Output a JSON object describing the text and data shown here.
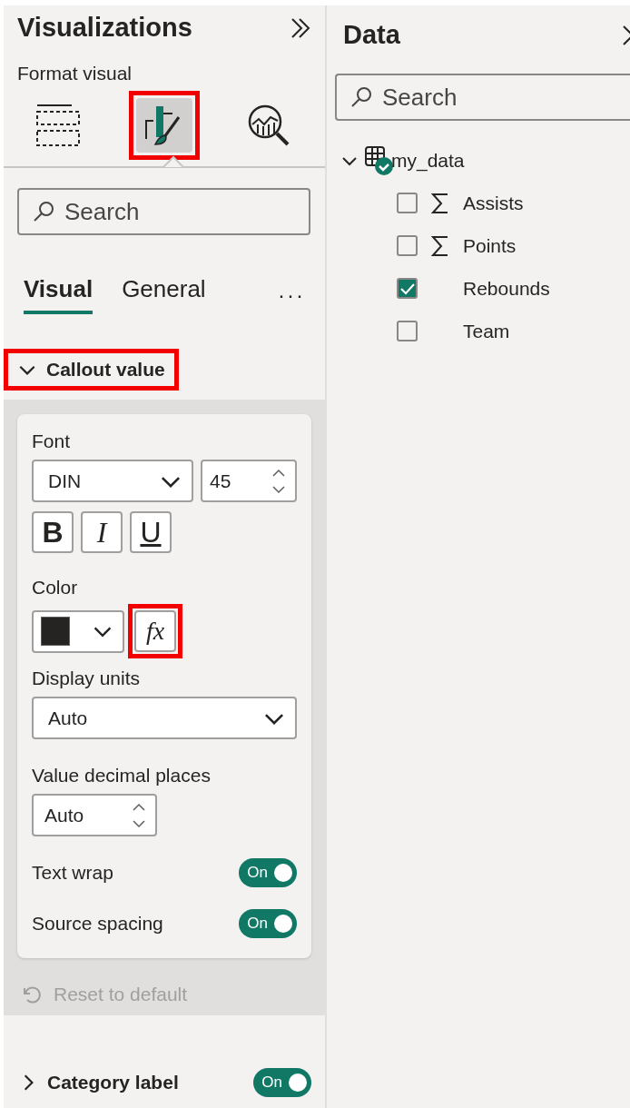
{
  "visualizations_pane": {
    "title": "Visualizations",
    "subtitle": "Format visual",
    "view_buttons": [
      {
        "kind": "build",
        "selected": false,
        "highlighted": false
      },
      {
        "kind": "format",
        "selected": true,
        "highlighted": true
      },
      {
        "kind": "analytics",
        "selected": false,
        "highlighted": false
      }
    ],
    "search": {
      "placeholder": "Search"
    },
    "tabs": [
      {
        "label": "Visual",
        "selected": true
      },
      {
        "label": "General",
        "selected": false
      }
    ],
    "more": "···",
    "callout_section": {
      "title": "Callout value",
      "expanded": true,
      "highlighted": true,
      "font": {
        "label": "Font",
        "family": "DIN",
        "size": "45",
        "styles": [
          {
            "kind": "bold",
            "label": "B"
          },
          {
            "kind": "italic",
            "label": "I"
          },
          {
            "kind": "underline",
            "label": "U"
          }
        ]
      },
      "color": {
        "label": "Color",
        "fx": {
          "label": "fx",
          "highlighted": true
        }
      },
      "display_units": {
        "label": "Display units",
        "value": "Auto"
      },
      "decimal_places": {
        "label": "Value decimal places",
        "value": "Auto"
      },
      "toggles": [
        {
          "label": "Text wrap",
          "on": true,
          "state_label": "On"
        },
        {
          "label": "Source spacing",
          "on": true,
          "state_label": "On"
        }
      ],
      "reset": {
        "label": "Reset to default",
        "disabled": true
      }
    },
    "category_section": {
      "title": "Category label",
      "expanded": false,
      "on": true,
      "state_label": "On"
    }
  },
  "data_pane": {
    "title": "Data",
    "search": {
      "placeholder": "Search"
    },
    "tree": [
      {
        "label": "my_data",
        "expanded": true,
        "children": [
          {
            "label": "Assists",
            "kind": "measure",
            "checked": false
          },
          {
            "label": "Points",
            "kind": "measure",
            "checked": false
          },
          {
            "label": "Rebounds",
            "kind": "field",
            "checked": true
          },
          {
            "label": "Team",
            "kind": "field",
            "checked": false
          }
        ]
      }
    ]
  }
}
